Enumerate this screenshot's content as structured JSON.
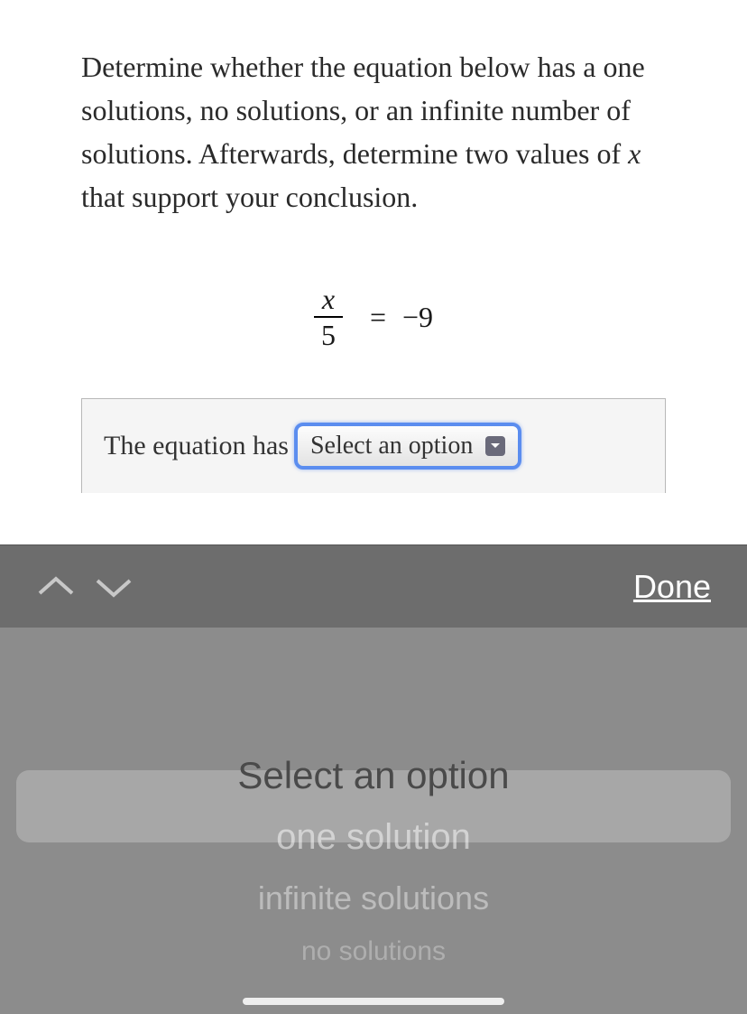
{
  "question": {
    "prompt_prefix": "Determine whether the equation below has a one solutions, no solutions, or an infinite number of solutions. Afterwards, determine two values of ",
    "prompt_var": "x",
    "prompt_suffix": " that support your conclusion."
  },
  "equation": {
    "numerator": "x",
    "denominator": "5",
    "equals": "=",
    "rhs": "−9"
  },
  "answer": {
    "prefix": "The equation has",
    "select_value": "Select an option"
  },
  "toolbar": {
    "done_label": "Done"
  },
  "picker": {
    "options": [
      "Select an option",
      "one solution",
      "infinite solutions",
      "no solutions"
    ]
  }
}
